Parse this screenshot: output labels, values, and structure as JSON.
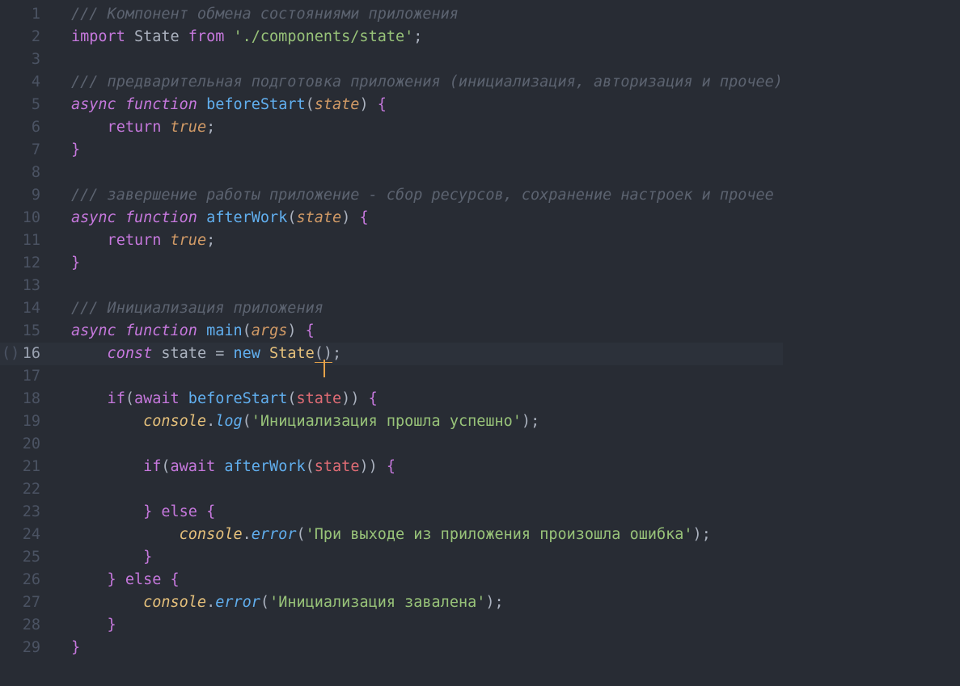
{
  "editor": {
    "current_line": 16,
    "gutter_marker": "()",
    "line_count": 29,
    "lines": {
      "l1": {
        "c1": "/// Компонент обмена состояниями приложения"
      },
      "l2": {
        "kw1": "import",
        "id1": " State ",
        "kw2": "from",
        "str1": " './components/state'",
        "p1": ";"
      },
      "l3": {
        "blank": ""
      },
      "l4": {
        "c1": "/// предварительная подготовка приложения (инициализация, авторизация и прочее)"
      },
      "l5": {
        "kw1": "async",
        "kw2": " function",
        "fn": " beforeStart",
        "p1": "(",
        "param": "state",
        "p2": ")",
        "brc": " {"
      },
      "l6": {
        "kw1": "    return ",
        "val": "true",
        "p1": ";"
      },
      "l7": {
        "brc": "}"
      },
      "l8": {
        "blank": ""
      },
      "l9": {
        "c1": "/// завершение работы приложение - сбор ресурсов, сохранение настроек и прочее"
      },
      "l10": {
        "kw1": "async",
        "kw2": " function",
        "fn": " afterWork",
        "p1": "(",
        "param": "state",
        "p2": ")",
        "brc": " {"
      },
      "l11": {
        "kw1": "    return ",
        "val": "true",
        "p1": ";"
      },
      "l12": {
        "brc": "}"
      },
      "l13": {
        "blank": ""
      },
      "l14": {
        "c1": "/// Инициализация приложения"
      },
      "l15": {
        "kw1": "async",
        "kw2": " function",
        "fn": " main",
        "p1": "(",
        "param": "args",
        "p2": ")",
        "brc": " {"
      },
      "l16": {
        "kw1": "    const",
        "id1": " state ",
        "eq": "= ",
        "kw2": "new",
        "cls": " State",
        "p1": "(",
        "p2": ")",
        "p3": ";"
      },
      "l17": {
        "blank": ""
      },
      "l18": {
        "kw1": "    if",
        "p1": "(",
        "kw2": "await",
        "fn": " beforeStart",
        "p2": "(",
        "arg": "state",
        "p3": ")",
        "p4": ")",
        "brc": " {"
      },
      "l19": {
        "pad": "        ",
        "obj": "console",
        "dot": ".",
        "m": "log",
        "p1": "(",
        "str": "'Инициализация прошла успешно'",
        "p2": ")",
        "p3": ";"
      },
      "l20": {
        "blank": ""
      },
      "l21": {
        "kw1": "        if",
        "p1": "(",
        "kw2": "await",
        "fn": " afterWork",
        "p2": "(",
        "arg": "state",
        "p3": ")",
        "p4": ")",
        "brc": " {"
      },
      "l22": {
        "blank": ""
      },
      "l23": {
        "brc1": "        }",
        "kw1": " else ",
        "brc2": "{"
      },
      "l24": {
        "pad": "            ",
        "obj": "console",
        "dot": ".",
        "m": "error",
        "p1": "(",
        "str": "'При выходе из приложения произошла ошибка'",
        "p2": ")",
        "p3": ";"
      },
      "l25": {
        "brc": "        }"
      },
      "l26": {
        "brc1": "    }",
        "kw1": " else ",
        "brc2": "{"
      },
      "l27": {
        "pad": "        ",
        "obj": "console",
        "dot": ".",
        "m": "error",
        "p1": "(",
        "str": "'Инициализация завалена'",
        "p2": ")",
        "p3": ";"
      },
      "l28": {
        "brc": "    }"
      },
      "l29": {
        "brc": "}"
      }
    }
  }
}
